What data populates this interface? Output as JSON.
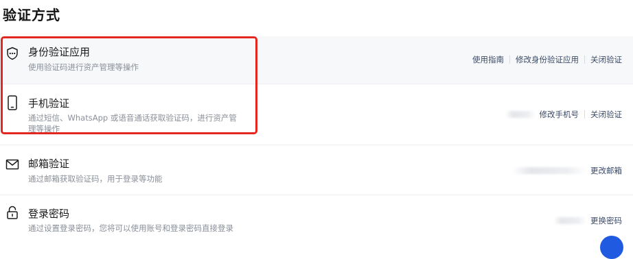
{
  "page": {
    "title": "验证方式"
  },
  "methods": [
    {
      "name": "身份验证应用",
      "desc": "使用验证码进行资产管理等操作",
      "icon": "shield-asterisk-icon",
      "actions": [
        "使用指南",
        "修改身份验证应用",
        "关闭验证"
      ]
    },
    {
      "name": "手机验证",
      "desc_line1": "通过短信、WhatsApp 或语音通话获取验证码，进行资产管",
      "desc_line2": "理等操作",
      "icon": "phone-icon",
      "actions": [
        "修改手机号",
        "关闭验证"
      ]
    },
    {
      "name": "邮箱验证",
      "desc": "通过邮箱获取验证码，用于登录等功能",
      "icon": "mail-icon",
      "actions": [
        "更改邮箱"
      ]
    },
    {
      "name": "登录密码",
      "desc": "通过设置登录密码，您将可以使用账号和登录密码直接登录",
      "icon": "lock-icon",
      "actions": [
        "更换密码"
      ]
    }
  ],
  "colors": {
    "highlight": "#e3261f",
    "link": "#3c4a66",
    "row_bg": "#f7f8fa"
  }
}
